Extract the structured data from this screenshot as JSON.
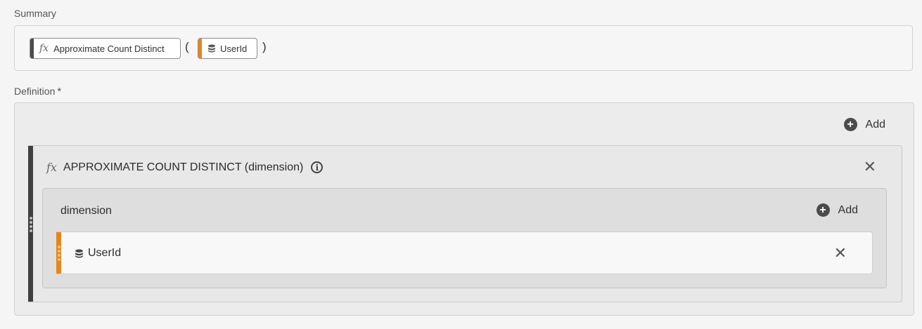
{
  "summary": {
    "label": "Summary",
    "function_pill": {
      "icon": "fx-icon",
      "label": "Approximate Count Distinct"
    },
    "open_paren": "(",
    "dimension_pill": {
      "icon": "database-icon",
      "label": "UserId"
    },
    "close_paren": ")"
  },
  "definition": {
    "label": "Definition",
    "required_marker": "*",
    "add_label": "Add",
    "function": {
      "icon": "fx-icon",
      "title": "APPROXIMATE COUNT DISTINCT (dimension)",
      "info_icon": "info-icon",
      "close_icon": "close-icon",
      "dimension_slot": {
        "label": "dimension",
        "add_label": "Add",
        "item": {
          "icon": "database-icon",
          "label": "UserId",
          "close_icon": "close-icon"
        }
      }
    }
  },
  "colors": {
    "function_accent": "#3f3f3f",
    "dimension_accent": "#e68619"
  }
}
